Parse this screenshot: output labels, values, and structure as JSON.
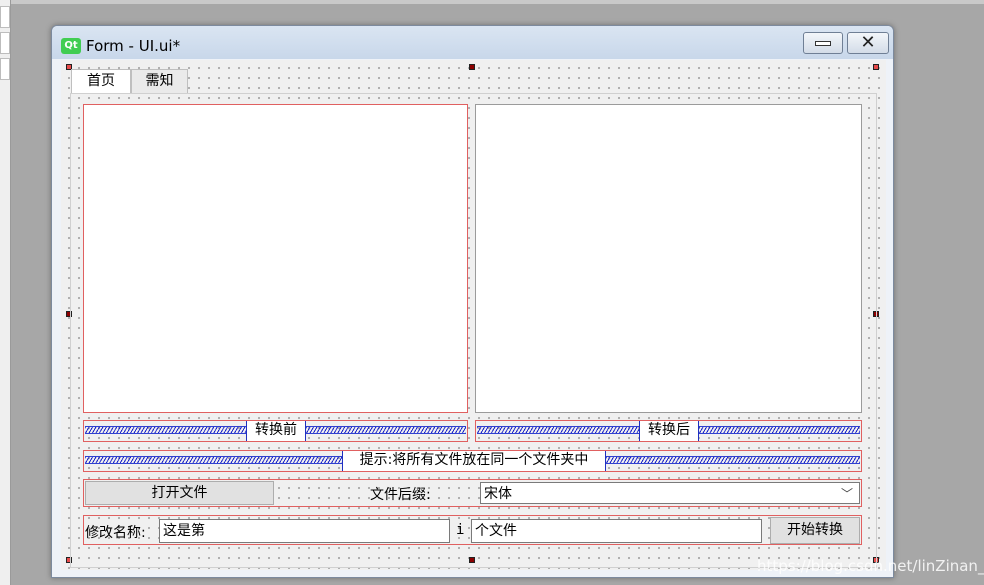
{
  "window": {
    "title": "Form - UI.ui*",
    "logo_text": "Qt",
    "minimize_icon": "minimize-icon",
    "close_icon": "close-icon"
  },
  "tabs": [
    {
      "label": "首页",
      "active": true
    },
    {
      "label": "需知",
      "active": false
    }
  ],
  "panels": {
    "before_label": "转换前",
    "after_label": "转换后"
  },
  "hint": {
    "text": "提示:将所有文件放在同一个文件夹中"
  },
  "file_row": {
    "open_button": "打开文件",
    "suffix_label": "文件后缀:",
    "suffix_select_value": "宋体"
  },
  "rename_row": {
    "label": "修改名称:",
    "prefix_value": "这是第",
    "index_label": "i",
    "suffix_value": "个文件",
    "start_button": "开始转换"
  },
  "watermark": "https://blog.csdn.net/linZinan_",
  "colors": {
    "selection_handle": "#8b0000",
    "spacer": "#1b25c8",
    "layout_frame": "#e06060"
  }
}
